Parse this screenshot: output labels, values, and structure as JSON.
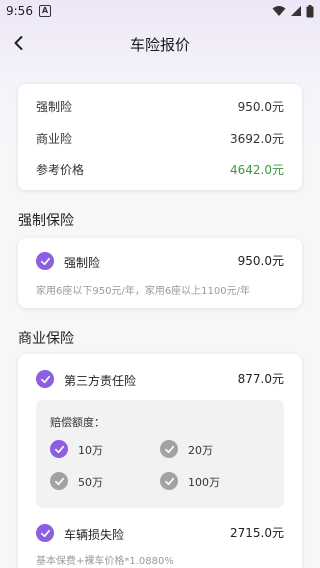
{
  "status_bar": {
    "time": "9:56",
    "app_badge": "A"
  },
  "header": {
    "title": "车险报价"
  },
  "summary": {
    "rows": [
      {
        "label": "强制险",
        "value": "950.0元"
      },
      {
        "label": "商业险",
        "value": "3692.0元"
      },
      {
        "label": "参考价格",
        "value": "4642.0元"
      }
    ]
  },
  "compulsory": {
    "section_title": "强制保险",
    "item_label": "强制险",
    "item_value": "950.0元",
    "note": "家用6座以下950元/年，家用6座以上1100元/年"
  },
  "commercial": {
    "section_title": "商业保险",
    "third_party": {
      "label": "第三方责任险",
      "value": "877.0元",
      "limit_label": "赔偿额度：",
      "options": [
        {
          "label": "10万",
          "selected": true
        },
        {
          "label": "20万",
          "selected": false
        },
        {
          "label": "50万",
          "selected": false
        },
        {
          "label": "100万",
          "selected": false
        }
      ]
    },
    "vehicle_damage": {
      "label": "车辆损失险",
      "value": "2715.0元",
      "note": "基本保费+裸车价格*1.0880%"
    }
  },
  "colors": {
    "accent": "#8c5fe0",
    "price_green": "#3a9a3a",
    "unselected": "#a2a2a2"
  }
}
